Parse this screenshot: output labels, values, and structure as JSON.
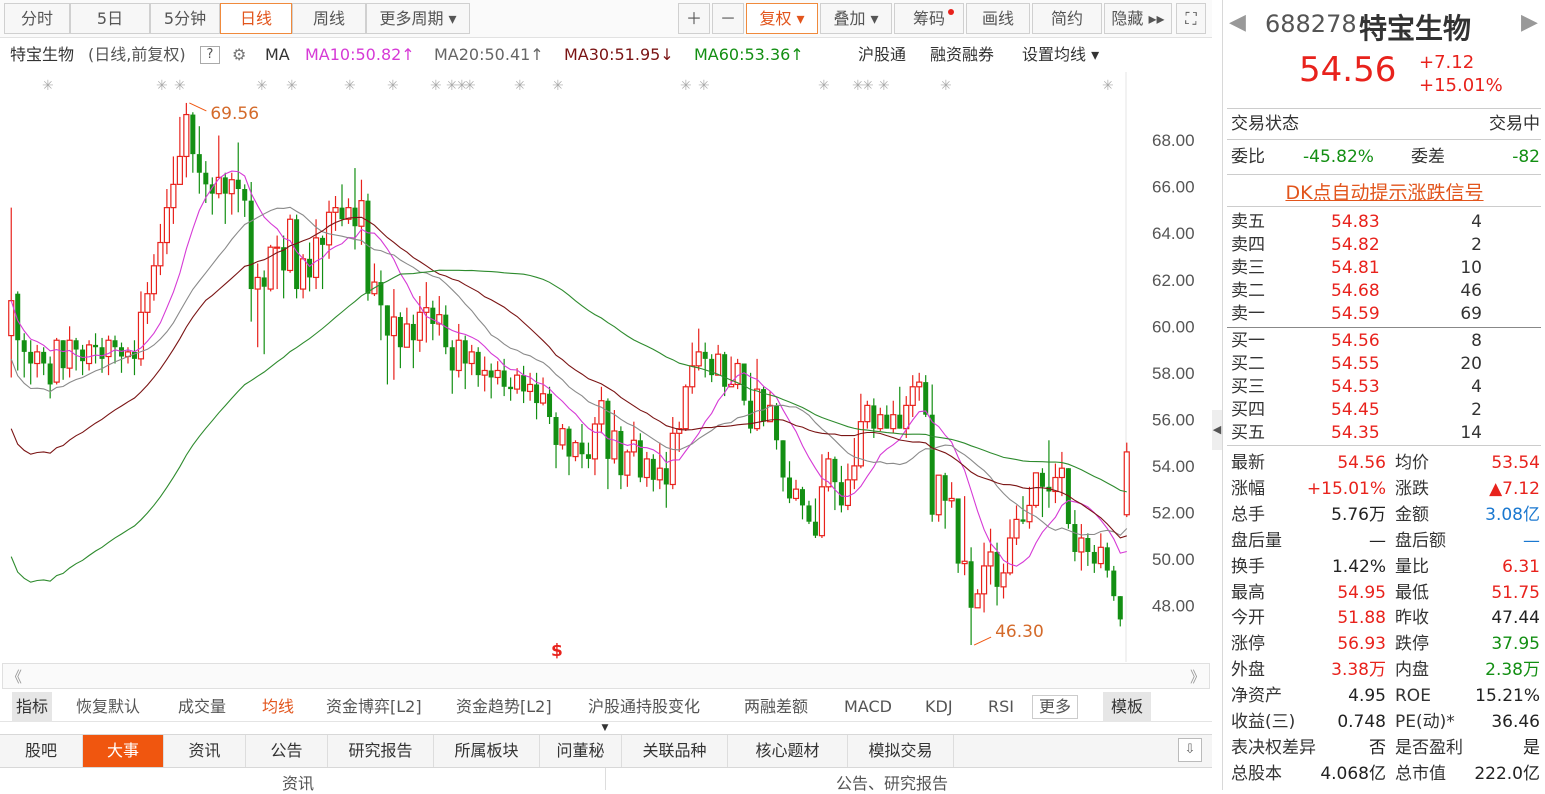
{
  "toolbar": {
    "periods": [
      "分时",
      "5日",
      "5分钟",
      "日线",
      "周线",
      "更多周期 ▾"
    ],
    "right_buttons": [
      "＋",
      "－",
      "复权 ▾",
      "叠加 ▾",
      "筹码",
      "画线",
      "简约",
      "隐藏 ▸▸",
      "⛶"
    ]
  },
  "info": {
    "stock_name": "特宝生物",
    "mode": "(日线,前复权)",
    "help": "?",
    "ma_label": "MA",
    "ma10": "MA10:50.82↑",
    "ma20": "MA20:50.41↑",
    "ma30": "MA30:51.95↓",
    "ma60": "MA60:53.36↑",
    "links": [
      "沪股通",
      "融资融券",
      "设置均线 ▾"
    ]
  },
  "colors": {
    "up": "#e8221c",
    "down": "#138f13",
    "ma10": "#d63ad6",
    "ma20": "#8a8a8a",
    "ma30": "#7a1414",
    "ma60": "#2e8b2e",
    "accent": "#f0560f"
  },
  "chart_data": {
    "type": "candlestick",
    "y_ticks": [
      "68.00",
      "66.00",
      "64.00",
      "62.00",
      "60.00",
      "58.00",
      "56.00",
      "54.00",
      "52.00",
      "50.00",
      "48.00"
    ],
    "ylim": [
      46,
      70.5
    ],
    "annot_high": "69.56",
    "annot_low": "46.30",
    "event_mark": "$",
    "candles": [
      [
        59.6,
        61.1,
        57.8,
        65.1
      ],
      [
        61.4,
        59.4,
        58.1,
        61.5
      ],
      [
        59.4,
        58.9,
        57.8,
        59.7
      ],
      [
        58.9,
        58.4,
        57.5,
        59.4
      ],
      [
        58.4,
        58.9,
        57.8,
        59.2
      ],
      [
        58.9,
        58.4,
        57.9,
        59.1
      ],
      [
        58.4,
        57.5,
        56.9,
        58.7
      ],
      [
        57.6,
        59.4,
        57.5,
        59.5
      ],
      [
        59.4,
        58.2,
        57.7,
        59.4
      ],
      [
        58.2,
        59.4,
        57.8,
        60.0
      ],
      [
        59.4,
        59.0,
        58.1,
        59.5
      ],
      [
        59.0,
        58.5,
        57.9,
        59.2
      ],
      [
        58.4,
        59.2,
        58.1,
        59.4
      ],
      [
        59.2,
        59.1,
        58.4,
        59.7
      ],
      [
        59.1,
        58.6,
        58.0,
        59.5
      ],
      [
        58.7,
        59.4,
        57.9,
        59.6
      ],
      [
        59.4,
        59.1,
        58.4,
        59.6
      ],
      [
        59.1,
        58.7,
        58.0,
        59.3
      ],
      [
        58.7,
        58.9,
        58.4,
        59.1
      ],
      [
        58.9,
        58.6,
        57.9,
        59.4
      ],
      [
        58.6,
        60.6,
        58.3,
        61.5
      ],
      [
        60.6,
        61.4,
        60.1,
        61.9
      ],
      [
        61.4,
        62.6,
        61.1,
        63.1
      ],
      [
        62.6,
        63.6,
        62.2,
        64.4
      ],
      [
        63.6,
        65.1,
        63.1,
        65.9
      ],
      [
        65.1,
        66.1,
        64.4,
        67.3
      ],
      [
        66.1,
        67.3,
        66.1,
        69.0
      ],
      [
        67.3,
        69.1,
        66.4,
        69.6
      ],
      [
        69.1,
        67.4,
        66.6,
        69.2
      ],
      [
        67.4,
        66.6,
        65.7,
        68.6
      ],
      [
        66.6,
        66.1,
        65.3,
        67.1
      ],
      [
        66.1,
        65.7,
        64.8,
        66.4
      ],
      [
        65.7,
        66.4,
        65.5,
        68.2
      ],
      [
        66.4,
        65.7,
        64.4,
        66.6
      ],
      [
        65.7,
        66.3,
        64.8,
        66.6
      ],
      [
        66.3,
        65.9,
        64.9,
        67.9
      ],
      [
        65.9,
        65.4,
        64.7,
        66.1
      ],
      [
        65.4,
        61.6,
        60.2,
        66.2
      ],
      [
        61.6,
        62.1,
        59.1,
        62.7
      ],
      [
        62.1,
        61.7,
        58.8,
        62.4
      ],
      [
        61.6,
        63.4,
        61.5,
        63.5
      ],
      [
        63.4,
        63.4,
        61.6,
        63.9
      ],
      [
        63.4,
        62.4,
        61.2,
        63.9
      ],
      [
        62.4,
        64.6,
        62.3,
        64.8
      ],
      [
        64.6,
        61.6,
        61.2,
        64.8
      ],
      [
        61.6,
        62.9,
        61.2,
        63.1
      ],
      [
        62.9,
        62.1,
        61.5,
        63.6
      ],
      [
        62.1,
        63.8,
        61.6,
        64.6
      ],
      [
        63.8,
        63.5,
        61.6,
        63.9
      ],
      [
        63.5,
        64.9,
        62.9,
        65.4
      ],
      [
        64.9,
        65.1,
        64.1,
        65.6
      ],
      [
        65.1,
        64.6,
        64.3,
        66.1
      ],
      [
        64.6,
        65.1,
        64.4,
        65.5
      ],
      [
        65.1,
        64.3,
        63.3,
        66.8
      ],
      [
        64.3,
        65.4,
        63.5,
        66.3
      ],
      [
        65.4,
        61.4,
        61.1,
        65.7
      ],
      [
        61.4,
        61.9,
        61.3,
        62.7
      ],
      [
        61.9,
        60.9,
        59.4,
        62.4
      ],
      [
        60.9,
        59.6,
        57.5,
        60.9
      ],
      [
        59.6,
        60.4,
        57.7,
        61.6
      ],
      [
        60.4,
        59.1,
        58.2,
        60.6
      ],
      [
        59.1,
        60.1,
        59.1,
        60.8
      ],
      [
        60.1,
        59.4,
        58.2,
        60.5
      ],
      [
        59.4,
        60.6,
        58.9,
        61.3
      ],
      [
        60.6,
        60.8,
        59.3,
        61.9
      ],
      [
        60.8,
        60.1,
        59.4,
        61.1
      ],
      [
        60.1,
        60.5,
        59.6,
        61.3
      ],
      [
        60.5,
        59.1,
        58.8,
        60.9
      ],
      [
        59.1,
        58.1,
        57.1,
        59.4
      ],
      [
        58.1,
        59.4,
        57.8,
        60.1
      ],
      [
        59.4,
        58.4,
        57.3,
        59.6
      ],
      [
        58.4,
        58.9,
        57.9,
        59.2
      ],
      [
        58.9,
        57.9,
        57.4,
        59.1
      ],
      [
        57.9,
        58.1,
        57.2,
        58.7
      ],
      [
        58.1,
        57.8,
        56.9,
        58.4
      ],
      [
        57.8,
        58.1,
        57.5,
        58.5
      ],
      [
        58.1,
        57.4,
        57.0,
        58.6
      ],
      [
        57.4,
        57.3,
        56.8,
        57.8
      ],
      [
        57.3,
        57.9,
        57.1,
        58.2
      ],
      [
        57.9,
        57.2,
        56.7,
        58.3
      ],
      [
        57.2,
        57.5,
        56.8,
        58.0
      ],
      [
        57.5,
        56.7,
        56.0,
        58.0
      ],
      [
        56.7,
        57.1,
        56.6,
        57.8
      ],
      [
        57.1,
        56.1,
        55.8,
        57.4
      ],
      [
        56.1,
        54.9,
        53.9,
        56.3
      ],
      [
        54.9,
        55.6,
        54.7,
        55.8
      ],
      [
        55.6,
        54.4,
        53.6,
        55.7
      ],
      [
        54.4,
        55.0,
        54.2,
        55.1
      ],
      [
        55.0,
        54.5,
        53.9,
        55.8
      ],
      [
        54.5,
        54.3,
        53.9,
        55.0
      ],
      [
        54.3,
        55.8,
        53.6,
        56.1
      ],
      [
        55.8,
        56.8,
        55.4,
        57.4
      ],
      [
        56.8,
        54.3,
        53.0,
        56.9
      ],
      [
        54.3,
        55.5,
        54.1,
        56.4
      ],
      [
        55.5,
        53.6,
        53.0,
        55.7
      ],
      [
        53.6,
        54.6,
        53.1,
        54.7
      ],
      [
        54.6,
        55.1,
        54.4,
        55.9
      ],
      [
        55.1,
        53.5,
        53.3,
        55.4
      ],
      [
        53.5,
        54.3,
        53.1,
        54.6
      ],
      [
        54.3,
        53.4,
        52.9,
        54.5
      ],
      [
        53.4,
        53.9,
        53.0,
        55.0
      ],
      [
        53.9,
        53.2,
        52.2,
        54.6
      ],
      [
        53.2,
        55.4,
        53.0,
        56.1
      ],
      [
        55.4,
        55.6,
        54.6,
        55.9
      ],
      [
        55.6,
        57.4,
        55.5,
        57.5
      ],
      [
        57.4,
        58.3,
        57.1,
        59.3
      ],
      [
        58.3,
        58.9,
        58.1,
        59.9
      ],
      [
        58.9,
        58.6,
        57.8,
        59.3
      ],
      [
        58.6,
        57.9,
        57.6,
        58.8
      ],
      [
        57.9,
        58.8,
        57.9,
        59.2
      ],
      [
        58.8,
        57.4,
        57.0,
        58.9
      ],
      [
        57.4,
        57.5,
        57.4,
        58.7
      ],
      [
        57.5,
        58.4,
        57.3,
        58.6
      ],
      [
        58.4,
        56.8,
        56.6,
        58.4
      ],
      [
        56.8,
        55.6,
        55.4,
        58.0
      ],
      [
        55.6,
        57.3,
        55.5,
        58.6
      ],
      [
        57.3,
        55.9,
        55.7,
        57.4
      ],
      [
        55.9,
        56.6,
        55.9,
        57.2
      ],
      [
        56.6,
        55.1,
        54.7,
        56.7
      ],
      [
        55.1,
        53.5,
        52.9,
        55.1
      ],
      [
        53.5,
        52.6,
        52.4,
        54.2
      ],
      [
        52.6,
        53.0,
        52.5,
        53.4
      ],
      [
        53.0,
        52.3,
        51.7,
        53.1
      ],
      [
        52.3,
        51.6,
        51.5,
        52.5
      ],
      [
        51.6,
        51.0,
        50.9,
        52.6
      ],
      [
        51.0,
        53.1,
        50.9,
        54.5
      ],
      [
        53.1,
        54.3,
        52.9,
        54.6
      ],
      [
        54.3,
        53.3,
        52.1,
        54.4
      ],
      [
        53.3,
        52.3,
        52.0,
        54.0
      ],
      [
        52.3,
        53.4,
        52.1,
        54.1
      ],
      [
        53.4,
        54.0,
        53.0,
        55.2
      ],
      [
        54.0,
        55.9,
        53.9,
        57.1
      ],
      [
        55.9,
        56.6,
        55.6,
        56.8
      ],
      [
        56.6,
        55.6,
        55.2,
        56.9
      ],
      [
        55.6,
        56.2,
        55.5,
        56.5
      ],
      [
        56.2,
        55.6,
        55.6,
        56.6
      ],
      [
        55.6,
        56.2,
        55.4,
        56.8
      ],
      [
        56.2,
        55.6,
        55.6,
        57.4
      ],
      [
        55.6,
        56.6,
        55.2,
        57.0
      ],
      [
        56.6,
        57.4,
        56.1,
        57.9
      ],
      [
        57.4,
        57.6,
        56.8,
        58.0
      ],
      [
        57.6,
        56.2,
        56.1,
        57.9
      ],
      [
        56.2,
        51.9,
        51.6,
        57.5
      ],
      [
        51.9,
        53.6,
        51.6,
        53.6
      ],
      [
        53.6,
        52.5,
        51.3,
        53.7
      ],
      [
        52.5,
        52.6,
        52.2,
        53.3
      ],
      [
        52.6,
        49.8,
        49.4,
        52.5
      ],
      [
        49.8,
        49.9,
        49.3,
        52.7
      ],
      [
        49.9,
        47.9,
        46.3,
        50.5
      ],
      [
        47.9,
        48.5,
        48.0,
        48.7
      ],
      [
        48.5,
        49.7,
        47.7,
        50.7
      ],
      [
        49.7,
        50.3,
        48.9,
        51.3
      ],
      [
        50.3,
        48.8,
        48.0,
        50.7
      ],
      [
        48.8,
        49.4,
        48.3,
        49.8
      ],
      [
        49.4,
        50.9,
        49.3,
        51.7
      ],
      [
        50.9,
        51.7,
        50.6,
        52.3
      ],
      [
        51.7,
        51.6,
        51.5,
        52.7
      ],
      [
        51.6,
        52.3,
        51.3,
        53.1
      ],
      [
        52.3,
        53.7,
        52.2,
        53.6
      ],
      [
        53.7,
        53.1,
        51.8,
        53.9
      ],
      [
        53.1,
        52.9,
        52.2,
        55.1
      ],
      [
        52.9,
        53.5,
        52.4,
        54.1
      ],
      [
        53.5,
        53.9,
        52.7,
        54.6
      ],
      [
        53.9,
        51.5,
        51.3,
        53.9
      ],
      [
        51.5,
        50.3,
        49.9,
        52.1
      ],
      [
        50.3,
        50.9,
        49.5,
        51.5
      ],
      [
        50.9,
        50.3,
        49.7,
        51.1
      ],
      [
        50.3,
        49.8,
        49.4,
        50.6
      ],
      [
        49.8,
        50.5,
        49.6,
        51.1
      ],
      [
        50.5,
        49.5,
        49.2,
        50.7
      ],
      [
        49.5,
        48.4,
        48.2,
        49.7
      ],
      [
        48.4,
        47.4,
        47.1,
        48.4
      ],
      [
        51.9,
        54.6,
        51.8,
        55.0
      ]
    ]
  },
  "scroll": {
    "left": "《",
    "right": "》"
  },
  "indicator_bar": {
    "items": [
      "指标",
      "恢复默认",
      "成交量",
      "均线",
      "资金博弈[L2]",
      "资金趋势[L2]",
      "沪股通持股变化",
      "两融差额",
      "MACD",
      "KDJ",
      "RSI",
      "更多",
      "模板"
    ]
  },
  "tabs": [
    "股吧",
    "大事",
    "资讯",
    "公告",
    "研究报告",
    "所属板块",
    "问董秘",
    "关联品种",
    "核心题材",
    "模拟交易"
  ],
  "bottom": {
    "left": "资讯",
    "right": "公告、研究报告"
  },
  "quote": {
    "nav_prev": "◀",
    "nav_next": "▶",
    "code": "688278",
    "name": "特宝生物",
    "price": "54.56",
    "change": "+7.12",
    "pct": "+15.01%",
    "status_label": "交易状态",
    "status_value": "交易中",
    "weibi_label": "委比",
    "weibi": "-45.82%",
    "weicha_label": "委差",
    "weicha": "-82",
    "signal": "DK点自动提示涨跌信号",
    "asks": [
      {
        "l": "卖五",
        "p": "54.83",
        "v": "4"
      },
      {
        "l": "卖四",
        "p": "54.82",
        "v": "2"
      },
      {
        "l": "卖三",
        "p": "54.81",
        "v": "10"
      },
      {
        "l": "卖二",
        "p": "54.68",
        "v": "46"
      },
      {
        "l": "卖一",
        "p": "54.59",
        "v": "69"
      }
    ],
    "bids": [
      {
        "l": "买一",
        "p": "54.56",
        "v": "8"
      },
      {
        "l": "买二",
        "p": "54.55",
        "v": "20"
      },
      {
        "l": "买三",
        "p": "54.53",
        "v": "4"
      },
      {
        "l": "买四",
        "p": "54.45",
        "v": "2"
      },
      {
        "l": "买五",
        "p": "54.35",
        "v": "14"
      }
    ],
    "stats": [
      [
        "最新",
        "54.56",
        "red",
        "均价",
        "53.54",
        "red"
      ],
      [
        "涨幅",
        "+15.01%",
        "red",
        "涨跌",
        "▲7.12",
        "red"
      ],
      [
        "总手",
        "5.76万",
        "dark",
        "金额",
        "3.08亿",
        "blue"
      ],
      [
        "盘后量",
        "—",
        "dark",
        "盘后额",
        "—",
        "blue"
      ],
      [
        "换手",
        "1.42%",
        "dark",
        "量比",
        "6.31",
        "red"
      ],
      [
        "最高",
        "54.95",
        "red",
        "最低",
        "51.75",
        "red"
      ],
      [
        "今开",
        "51.88",
        "red",
        "昨收",
        "47.44",
        "dark"
      ],
      [
        "涨停",
        "56.93",
        "red",
        "跌停",
        "37.95",
        "green"
      ],
      [
        "外盘",
        "3.38万",
        "red",
        "内盘",
        "2.38万",
        "green"
      ],
      [
        "净资产",
        "4.95",
        "dark",
        "ROE",
        "15.21%",
        "dark"
      ],
      [
        "收益(三)",
        "0.748",
        "dark",
        "PE(动)*",
        "36.46",
        "dark"
      ],
      [
        "表决权差异",
        "否",
        "dark",
        "是否盈利",
        "是",
        "dark"
      ],
      [
        "总股本",
        "4.068亿",
        "dark",
        "总市值",
        "222.0亿",
        "dark"
      ]
    ]
  }
}
